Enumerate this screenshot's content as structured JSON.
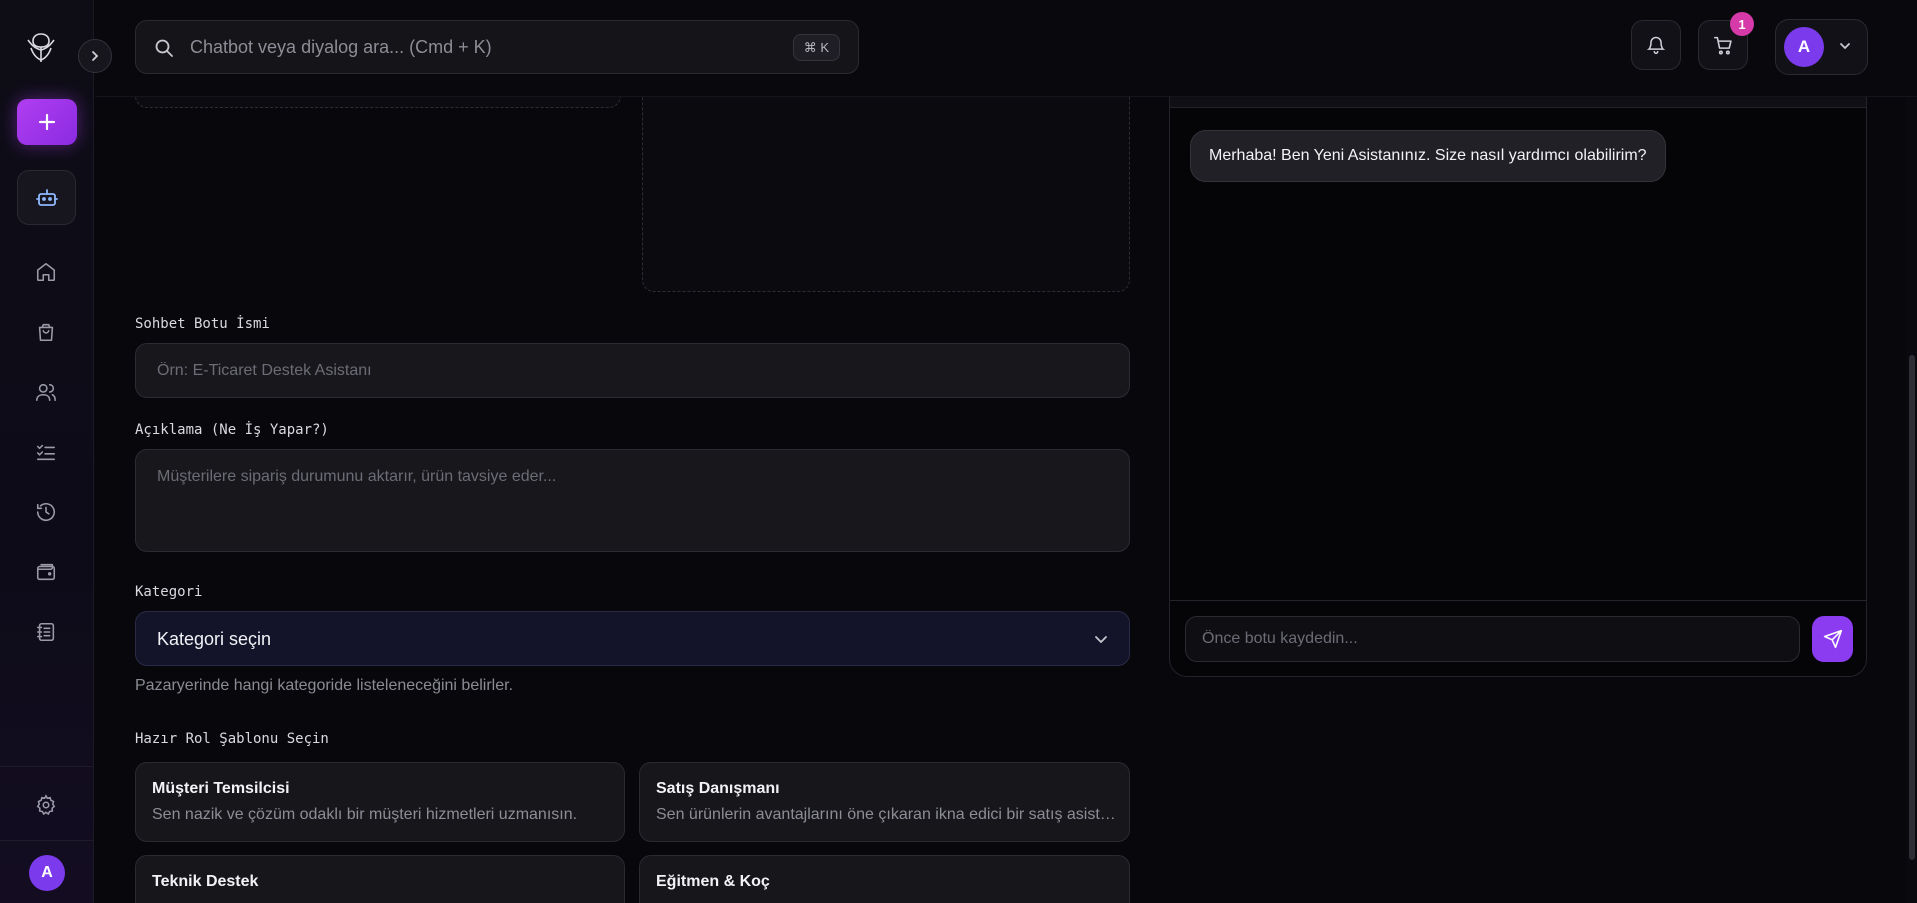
{
  "search": {
    "placeholder": "Chatbot veya diyalog ara... (Cmd + K)",
    "shortcut": "⌘ K"
  },
  "header": {
    "cart_count": "1",
    "user_initial": "A"
  },
  "sidebar": {
    "user_initial": "A",
    "accent": "#8b5cf6"
  },
  "form": {
    "name_label": "Sohbet Botu İsmi",
    "name_placeholder": "Örn: E-Ticaret Destek Asistanı",
    "desc_label": "Açıklama (Ne İş Yapar?)",
    "desc_placeholder": "Müşterilere sipariş durumunu aktarır, ürün tavsiye eder...",
    "category_label": "Kategori",
    "category_value": "Kategori seçin",
    "category_hint": "Pazaryerinde hangi kategoride listeleneceğini belirler.",
    "roles_label": "Hazır Rol Şablonu Seçin",
    "roles": [
      {
        "title": "Müşteri Temsilcisi",
        "desc": "Sen nazik ve çözüm odaklı bir müşteri hizmetleri uzmanısın."
      },
      {
        "title": "Satış Danışmanı",
        "desc": "Sen ürünlerin avantajlarını öne çıkaran ikna edici bir satış asistanısın."
      },
      {
        "title": "Teknik Destek",
        "desc": ""
      },
      {
        "title": "Eğitmen & Koç",
        "desc": ""
      }
    ]
  },
  "chat": {
    "greeting": "Merhaba! Ben Yeni Asistanınız. Size nasıl yardımcı olabilirim?",
    "input_placeholder": "Önce botu kaydedin..."
  }
}
